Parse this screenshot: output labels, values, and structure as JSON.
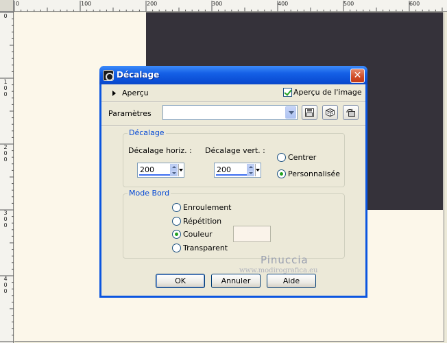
{
  "ruler": {
    "top_labels": [
      "0",
      "100",
      "200",
      "300",
      "400",
      "500",
      "600"
    ],
    "left_labels": [
      [
        "0"
      ],
      [
        "1",
        "0",
        "0"
      ],
      [
        "2",
        "0",
        "0"
      ],
      [
        "3",
        "0",
        "0"
      ],
      [
        "4",
        "0",
        "0"
      ]
    ]
  },
  "canvas": {
    "background": "#fcf7ea",
    "dark_color": "#35323a"
  },
  "dialog": {
    "title": "Décalage",
    "close_label": "✕",
    "apercu_label": "Aperçu",
    "preview_check_label": "Aperçu de l'image",
    "preview_checked": true,
    "params_label": "Paramètres",
    "params_value": "",
    "offset_group": {
      "title": "Décalage",
      "horiz_label": "Décalage horiz. :",
      "horiz_value": "200",
      "vert_label": "Décalage vert. :",
      "vert_value": "200",
      "center_label": "Centrer",
      "custom_label": "Personnalisée",
      "selected": "Personnalisée"
    },
    "edge_group": {
      "title": "Mode Bord",
      "options": [
        "Enroulement",
        "Répétition",
        "Couleur",
        "Transparent"
      ],
      "selected": "Couleur",
      "swatch_color": "#faf3ea"
    },
    "watermark_name": "Pinuccia",
    "watermark_url": "www.modirografica.eu",
    "ok_label": "OK",
    "cancel_label": "Annuler",
    "help_label": "Aide"
  }
}
